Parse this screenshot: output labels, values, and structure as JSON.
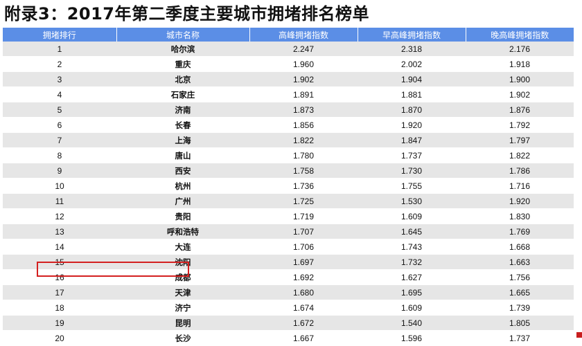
{
  "title": "附录3：2017年第二季度主要城市拥堵排名榜单",
  "table": {
    "headers": [
      "拥堵排行",
      "城市名称",
      "高峰拥堵指数",
      "早高峰拥堵指数",
      "晚高峰拥堵指数"
    ],
    "rows": [
      {
        "rank": "1",
        "city": "哈尔滨",
        "peak": "2.247",
        "am": "2.318",
        "pm": "2.176"
      },
      {
        "rank": "2",
        "city": "重庆",
        "peak": "1.960",
        "am": "2.002",
        "pm": "1.918"
      },
      {
        "rank": "3",
        "city": "北京",
        "peak": "1.902",
        "am": "1.904",
        "pm": "1.900"
      },
      {
        "rank": "4",
        "city": "石家庄",
        "peak": "1.891",
        "am": "1.881",
        "pm": "1.902"
      },
      {
        "rank": "5",
        "city": "济南",
        "peak": "1.873",
        "am": "1.870",
        "pm": "1.876"
      },
      {
        "rank": "6",
        "city": "长春",
        "peak": "1.856",
        "am": "1.920",
        "pm": "1.792"
      },
      {
        "rank": "7",
        "city": "上海",
        "peak": "1.822",
        "am": "1.847",
        "pm": "1.797"
      },
      {
        "rank": "8",
        "city": "唐山",
        "peak": "1.780",
        "am": "1.737",
        "pm": "1.822"
      },
      {
        "rank": "9",
        "city": "西安",
        "peak": "1.758",
        "am": "1.730",
        "pm": "1.786"
      },
      {
        "rank": "10",
        "city": "杭州",
        "peak": "1.736",
        "am": "1.755",
        "pm": "1.716"
      },
      {
        "rank": "11",
        "city": "广州",
        "peak": "1.725",
        "am": "1.530",
        "pm": "1.920"
      },
      {
        "rank": "12",
        "city": "贵阳",
        "peak": "1.719",
        "am": "1.609",
        "pm": "1.830"
      },
      {
        "rank": "13",
        "city": "呼和浩特",
        "peak": "1.707",
        "am": "1.645",
        "pm": "1.769"
      },
      {
        "rank": "14",
        "city": "大连",
        "peak": "1.706",
        "am": "1.743",
        "pm": "1.668"
      },
      {
        "rank": "15",
        "city": "沈阳",
        "peak": "1.697",
        "am": "1.732",
        "pm": "1.663"
      },
      {
        "rank": "16",
        "city": "成都",
        "peak": "1.692",
        "am": "1.627",
        "pm": "1.756"
      },
      {
        "rank": "17",
        "city": "天津",
        "peak": "1.680",
        "am": "1.695",
        "pm": "1.665"
      },
      {
        "rank": "18",
        "city": "济宁",
        "peak": "1.674",
        "am": "1.609",
        "pm": "1.739"
      },
      {
        "rank": "19",
        "city": "昆明",
        "peak": "1.672",
        "am": "1.540",
        "pm": "1.805"
      },
      {
        "rank": "20",
        "city": "长沙",
        "peak": "1.667",
        "am": "1.596",
        "pm": "1.737"
      }
    ],
    "highlighted_rank": "16"
  },
  "colors": {
    "header_bg": "#5b8ee6",
    "row_stripe": "#e6e6e6",
    "highlight_border": "#d42020"
  }
}
